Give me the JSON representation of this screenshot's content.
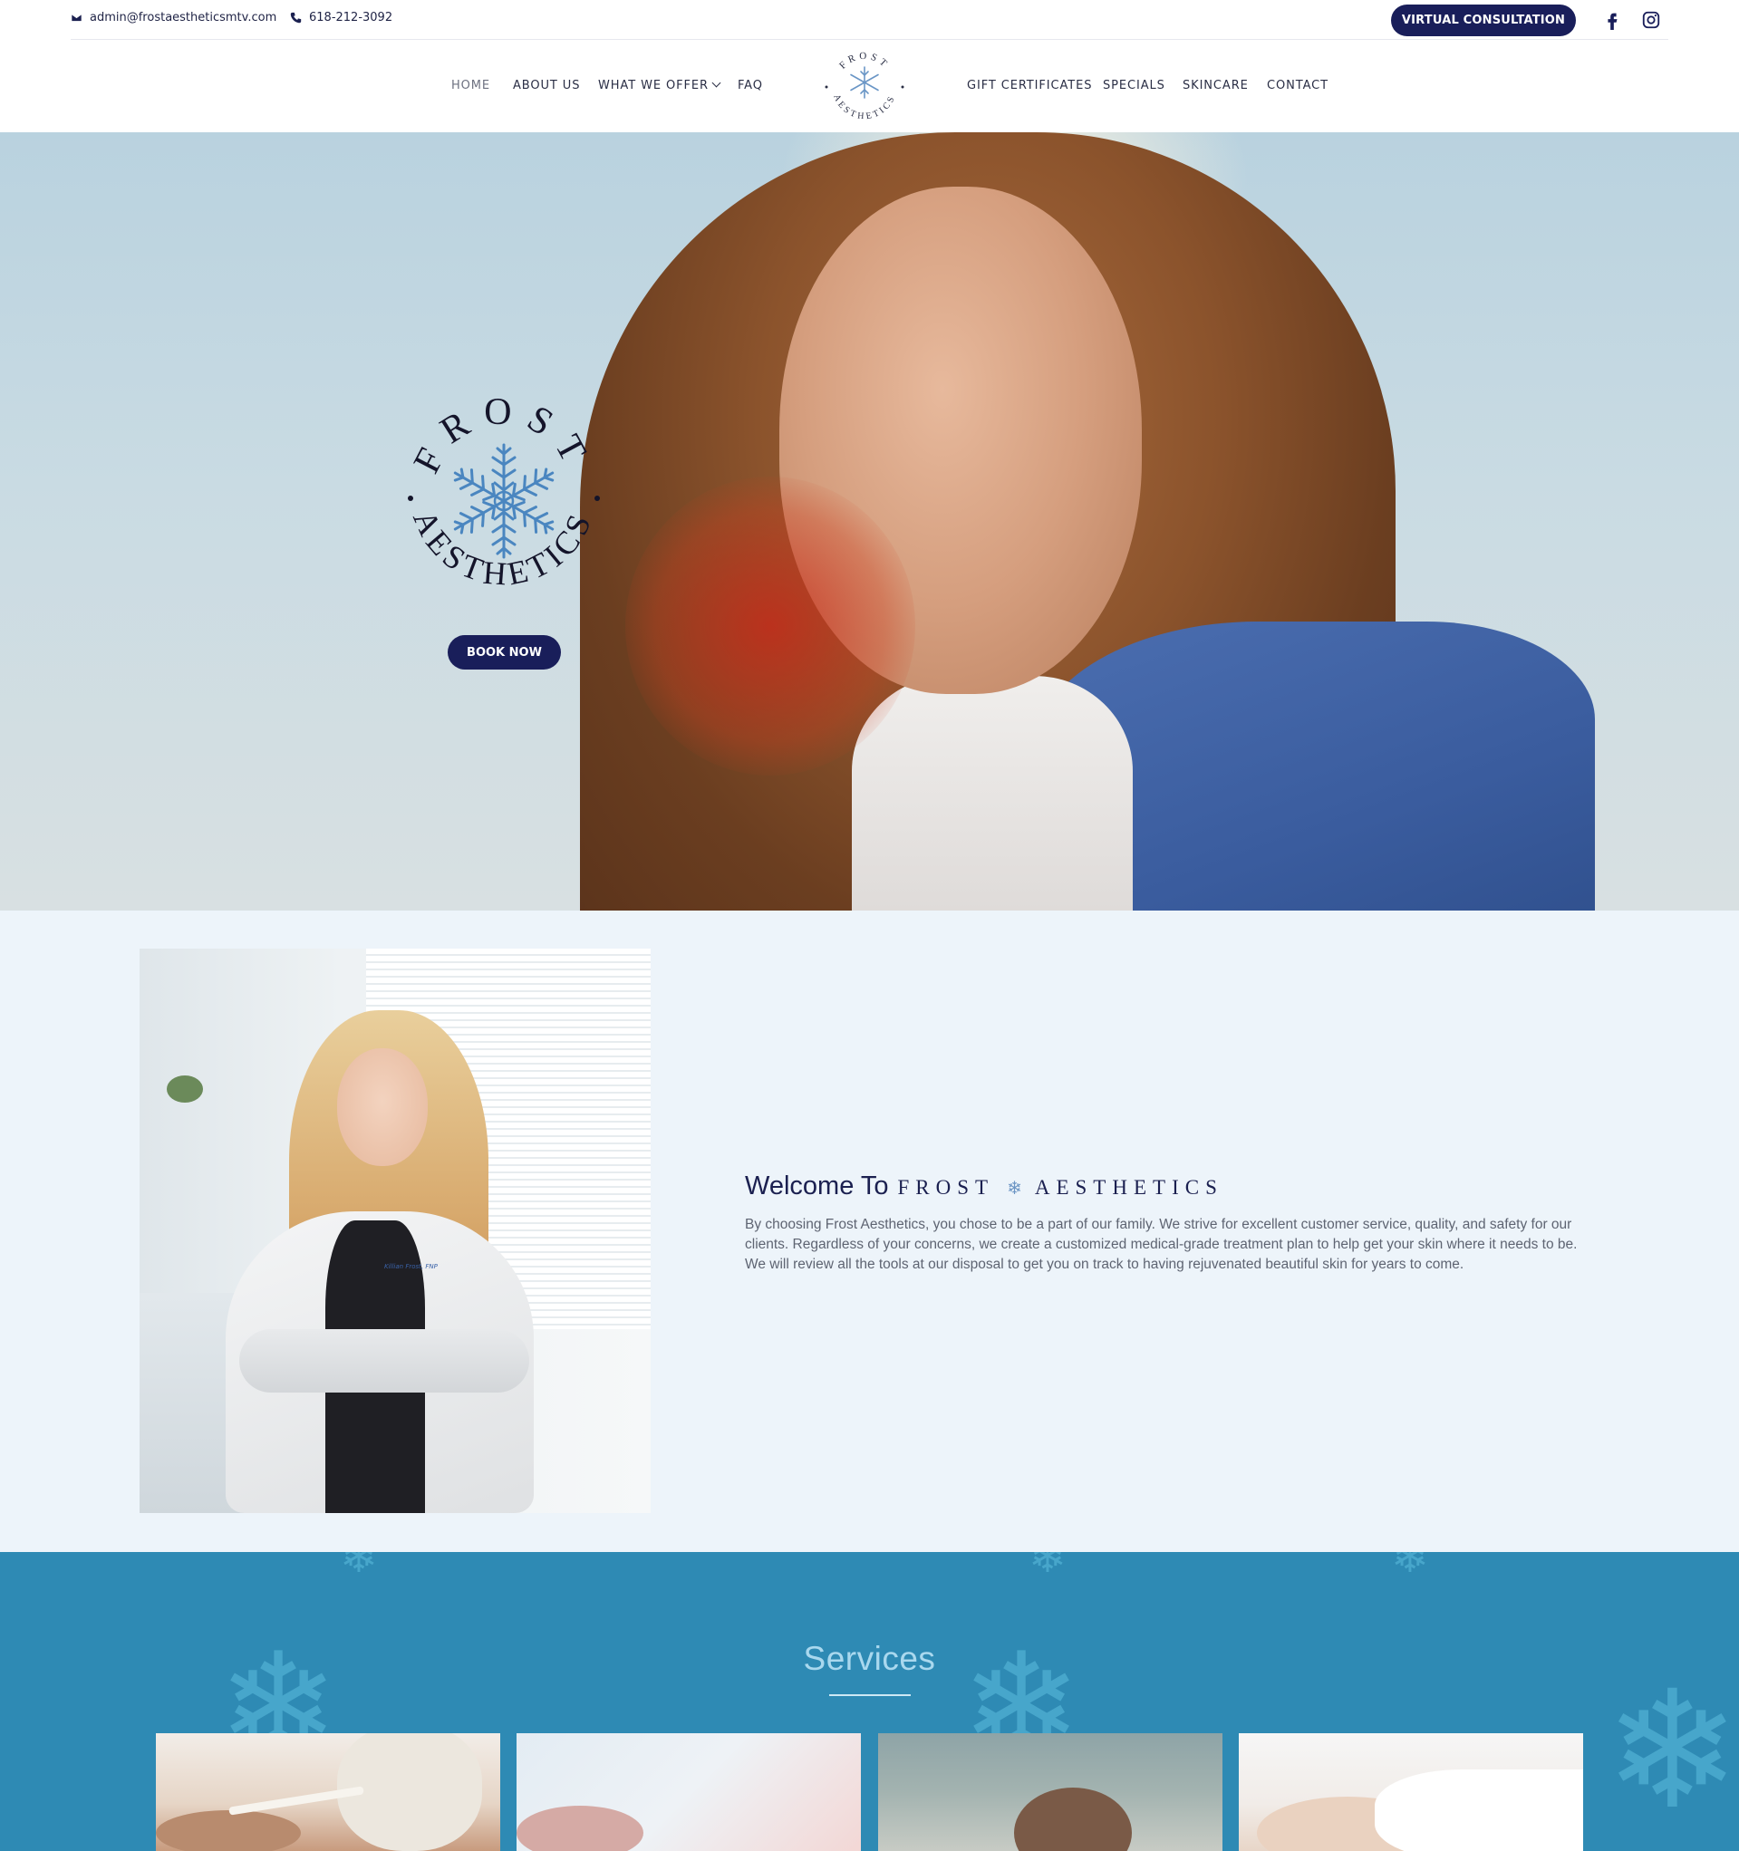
{
  "topbar": {
    "email": "admin@frostaestheticsmtv.com",
    "phone": "618-212-3092",
    "virtual_button": "VIRTUAL CONSULTATION",
    "social": [
      {
        "icon": "facebook-icon"
      },
      {
        "icon": "instagram-icon"
      }
    ]
  },
  "nav": {
    "left_items": [
      {
        "label": "HOME",
        "active": true
      },
      {
        "label": "ABOUT US"
      },
      {
        "label": "WHAT WE OFFER",
        "has_dropdown": true
      },
      {
        "label": "FAQ"
      }
    ],
    "right_items": [
      {
        "label": "GIFT CERTIFICATES"
      },
      {
        "label": "SPECIALS"
      },
      {
        "label": "SKINCARE"
      },
      {
        "label": "CONTACT"
      }
    ],
    "logo_top": "FROST",
    "logo_bottom": "AESTHETICS"
  },
  "hero": {
    "logo_top": "FROST",
    "logo_bottom": "AESTHETICS",
    "book_button": "BOOK NOW"
  },
  "welcome": {
    "title_lead": "Welcome To",
    "title_brand_1": "FROST",
    "title_brand_2": "AESTHETICS",
    "body": "By choosing Frost Aesthetics, you chose to be a part of our family. We strive for excellent customer service, quality, and safety for our clients. Regardless of your concerns, we create a customized medical-grade treatment plan to help get your skin where it needs to be. We will review all the tools at our disposal to get you on track to having rejuvenated beautiful skin for years to come.",
    "badge_text": "Killian Frost, FNP"
  },
  "services": {
    "title": "Services"
  },
  "colors": {
    "navy": "#191e5a",
    "welcome_bg": "#edf4fa",
    "services_bg": "#2e8ab4",
    "snowflake": "#4a86c0"
  }
}
